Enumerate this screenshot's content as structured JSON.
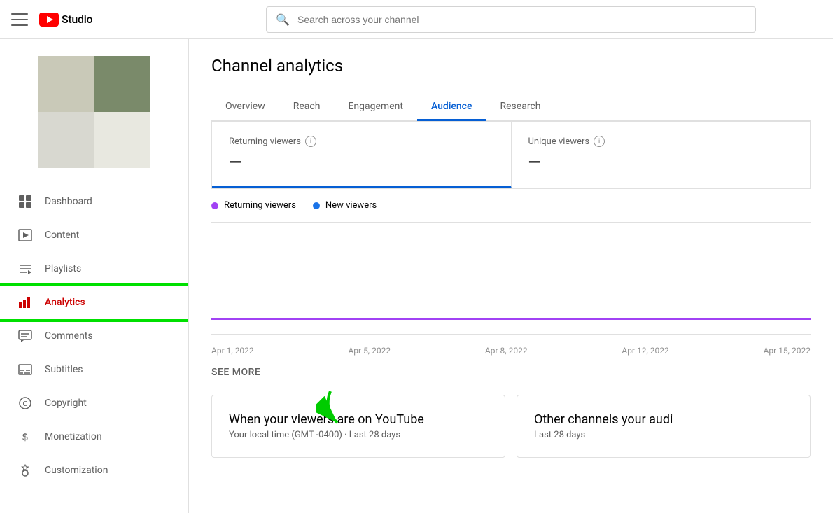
{
  "header": {
    "menu_label": "Menu",
    "logo_text": "Studio",
    "search_placeholder": "Search across your channel"
  },
  "sidebar": {
    "nav_items": [
      {
        "id": "dashboard",
        "label": "Dashboard",
        "icon": "grid"
      },
      {
        "id": "content",
        "label": "Content",
        "icon": "play-box"
      },
      {
        "id": "playlists",
        "label": "Playlists",
        "icon": "list"
      },
      {
        "id": "analytics",
        "label": "Analytics",
        "icon": "bar-chart",
        "active": true
      },
      {
        "id": "comments",
        "label": "Comments",
        "icon": "comment"
      },
      {
        "id": "subtitles",
        "label": "Subtitles",
        "icon": "subtitles"
      },
      {
        "id": "copyright",
        "label": "Copyright",
        "icon": "copyright"
      },
      {
        "id": "monetization",
        "label": "Monetization",
        "icon": "dollar"
      },
      {
        "id": "customization",
        "label": "Customization",
        "icon": "settings"
      }
    ]
  },
  "main": {
    "page_title": "Channel analytics",
    "tabs": [
      {
        "id": "overview",
        "label": "Overview",
        "active": false
      },
      {
        "id": "reach",
        "label": "Reach",
        "active": false
      },
      {
        "id": "engagement",
        "label": "Engagement",
        "active": false
      },
      {
        "id": "audience",
        "label": "Audience",
        "active": true
      },
      {
        "id": "research",
        "label": "Research",
        "active": false
      }
    ],
    "stats": [
      {
        "label": "Returning viewers",
        "value": "—",
        "has_info": true,
        "active": true
      },
      {
        "label": "Unique viewers",
        "value": "—",
        "has_info": true,
        "active": false
      }
    ],
    "legend": [
      {
        "label": "Returning viewers",
        "color": "purple"
      },
      {
        "label": "New viewers",
        "color": "blue"
      }
    ],
    "chart_labels": [
      "Apr 1, 2022",
      "Apr 5, 2022",
      "Apr 8, 2022",
      "Apr 12, 2022",
      "Apr 15, 2022"
    ],
    "see_more": "SEE MORE",
    "bottom_cards": [
      {
        "title": "When your viewers are on YouTube",
        "subtitle": "Your local time (GMT -0400) · Last 28 days"
      },
      {
        "title": "Other channels your audi",
        "subtitle": "Last 28 days"
      }
    ]
  }
}
